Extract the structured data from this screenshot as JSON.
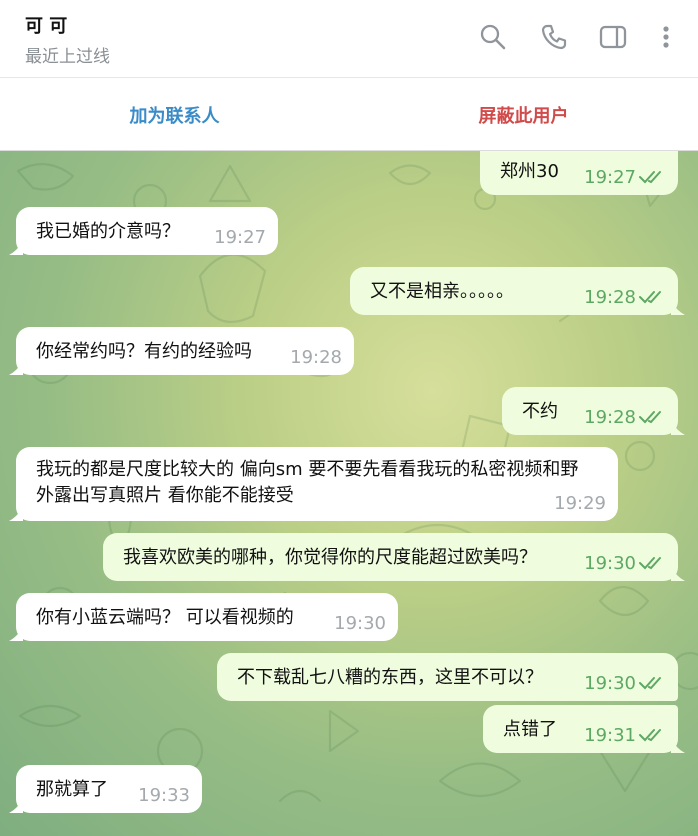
{
  "header": {
    "title": "可 可",
    "status": "最近上过线",
    "icons": [
      "search-icon",
      "phone-icon",
      "sidebar-toggle-icon",
      "more-vertical-icon"
    ]
  },
  "actions": {
    "add_contact": "加为联系人",
    "block_user": "屏蔽此用户"
  },
  "colors": {
    "incoming_bubble": "#ffffff",
    "outgoing_bubble": "#effdde",
    "outgoing_time": "#5da863",
    "add_contact": "#3a8cc8",
    "block_user": "#d24b4b"
  },
  "messages": [
    {
      "dir": "out",
      "text": "郑州30",
      "time": "19:27",
      "read": true
    },
    {
      "dir": "in",
      "text": "我已婚的介意吗？",
      "time": "19:27"
    },
    {
      "dir": "out",
      "text": "又不是相亲。。。。。",
      "time": "19:28",
      "read": true
    },
    {
      "dir": "in",
      "text": "你经常约吗？有约的经验吗",
      "time": "19:28"
    },
    {
      "dir": "out",
      "text": "不约",
      "time": "19:28",
      "read": true
    },
    {
      "dir": "in",
      "text": "我玩的都是尺度比较大的   偏向sm 要不要先看看我玩的私密视频和野外露出写真照片 看你能不能接受",
      "time": "19:29"
    },
    {
      "dir": "out",
      "text": "我喜欢欧美的哪种，你觉得你的尺度能超过欧美吗？",
      "time": "19:30",
      "read": true
    },
    {
      "dir": "in",
      "text": "你有小蓝云端吗？ 可以看视频的",
      "time": "19:30"
    },
    {
      "dir": "out",
      "text": "不下载乱七八糟的东西，这里不可以？",
      "time": "19:30",
      "read": true
    },
    {
      "dir": "out",
      "text": "点错了",
      "time": "19:31",
      "read": true
    },
    {
      "dir": "in",
      "text": "那就算了",
      "time": "19:33"
    }
  ]
}
